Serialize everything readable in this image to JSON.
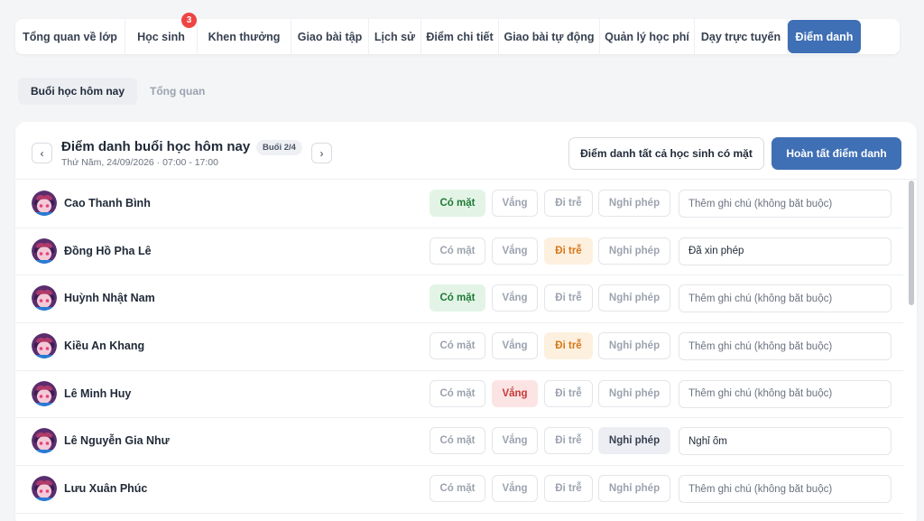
{
  "tabs": [
    {
      "label": "Tổng quan về lớp",
      "active": false
    },
    {
      "label": "Học sinh",
      "active": false,
      "badge": "3"
    },
    {
      "label": "Khen thưởng",
      "active": false
    },
    {
      "label": "Giao bài tập",
      "active": false
    },
    {
      "label": "Lịch sử",
      "active": false
    },
    {
      "label": "Điểm chi tiết",
      "active": false
    },
    {
      "label": "Giao bài tự động",
      "active": false
    },
    {
      "label": "Quản lý học phí",
      "active": false
    },
    {
      "label": "Dạy trực tuyến",
      "active": false
    },
    {
      "label": "Điểm danh",
      "active": true
    }
  ],
  "subtabs": [
    {
      "label": "Buổi học hôm nay",
      "active": true
    },
    {
      "label": "Tổng quan",
      "active": false
    }
  ],
  "header": {
    "title": "Điểm danh buổi học hôm nay",
    "session": "Buổi 2/4",
    "subtitle": "Thứ Năm, 24/09/2026 · 07:00 - 17:00",
    "prev_icon": "chevron-left-icon",
    "next_icon": "chevron-right-icon",
    "mark_all_label": "Điểm danh tất cả học sinh có mặt",
    "finish_label": "Hoàn tất điểm danh"
  },
  "status_labels": {
    "present": "Có mặt",
    "absent": "Vắng",
    "late": "Đi trễ",
    "leave": "Nghỉ phép"
  },
  "note_placeholder": "Thêm ghi chú (không bắt buộc)",
  "students": [
    {
      "name": "Cao Thanh Bình",
      "status": "present",
      "note": ""
    },
    {
      "name": "Đồng Hồ Pha Lê",
      "status": "late",
      "note": "Đã xin phép"
    },
    {
      "name": "Huỳnh Nhật Nam",
      "status": "present",
      "note": ""
    },
    {
      "name": "Kiều An Khang",
      "status": "late",
      "note": ""
    },
    {
      "name": "Lê Minh Huy",
      "status": "absent",
      "note": ""
    },
    {
      "name": "Lê Nguyễn Gia Như",
      "status": "leave",
      "note": "Nghỉ ốm"
    },
    {
      "name": "Lưu Xuân Phúc",
      "status": "",
      "note": ""
    }
  ],
  "colors": {
    "accent": "#3f6fb5",
    "present": "#1f7a37",
    "absent": "#c83838",
    "late": "#d7771a",
    "badge": "#ef4444"
  }
}
